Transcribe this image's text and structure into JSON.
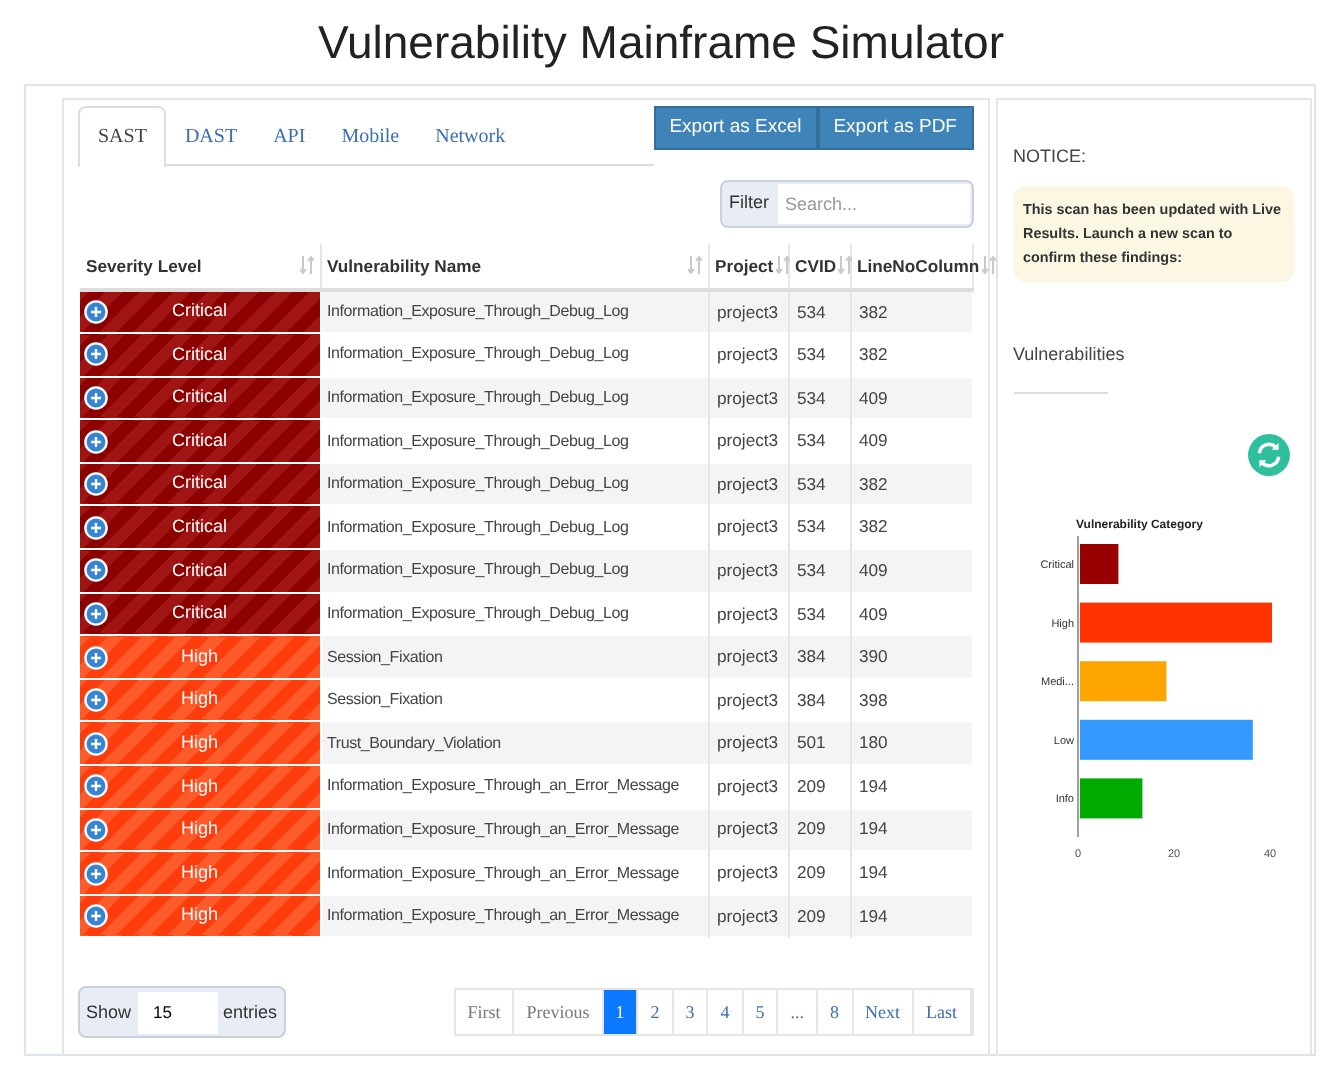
{
  "title": "Vulnerability Mainframe Simulator",
  "tabs": [
    {
      "label": "SAST",
      "selected": true
    },
    {
      "label": "DAST",
      "selected": false
    },
    {
      "label": "API",
      "selected": false
    },
    {
      "label": "Mobile",
      "selected": false
    },
    {
      "label": "Network",
      "selected": false
    }
  ],
  "export_buttons": [
    "Export as Excel",
    "Export as PDF"
  ],
  "filter": {
    "label": "Filter",
    "placeholder": "Search..."
  },
  "table": {
    "columns": [
      "Severity Level",
      "Vulnerability Name",
      "Project",
      "CVID",
      "LineNoColumn"
    ],
    "rows": [
      {
        "kind": "critical",
        "severity": "Critical",
        "name": "Information_Exposure_Through_Debug_Log",
        "project": "project3",
        "cvid": "534",
        "line": "382"
      },
      {
        "kind": "critical",
        "severity": "Critical",
        "name": "Information_Exposure_Through_Debug_Log",
        "project": "project3",
        "cvid": "534",
        "line": "382"
      },
      {
        "kind": "critical",
        "severity": "Critical",
        "name": "Information_Exposure_Through_Debug_Log",
        "project": "project3",
        "cvid": "534",
        "line": "409"
      },
      {
        "kind": "critical",
        "severity": "Critical",
        "name": "Information_Exposure_Through_Debug_Log",
        "project": "project3",
        "cvid": "534",
        "line": "409"
      },
      {
        "kind": "critical",
        "severity": "Critical",
        "name": "Information_Exposure_Through_Debug_Log",
        "project": "project3",
        "cvid": "534",
        "line": "382"
      },
      {
        "kind": "critical",
        "severity": "Critical",
        "name": "Information_Exposure_Through_Debug_Log",
        "project": "project3",
        "cvid": "534",
        "line": "382"
      },
      {
        "kind": "critical",
        "severity": "Critical",
        "name": "Information_Exposure_Through_Debug_Log",
        "project": "project3",
        "cvid": "534",
        "line": "409"
      },
      {
        "kind": "critical",
        "severity": "Critical",
        "name": "Information_Exposure_Through_Debug_Log",
        "project": "project3",
        "cvid": "534",
        "line": "409"
      },
      {
        "kind": "high",
        "severity": "High",
        "name": "Session_Fixation",
        "project": "project3",
        "cvid": "384",
        "line": "390"
      },
      {
        "kind": "high",
        "severity": "High",
        "name": "Session_Fixation",
        "project": "project3",
        "cvid": "384",
        "line": "398"
      },
      {
        "kind": "high",
        "severity": "High",
        "name": "Trust_Boundary_Violation",
        "project": "project3",
        "cvid": "501",
        "line": "180"
      },
      {
        "kind": "high",
        "severity": "High",
        "name": "Information_Exposure_Through_an_Error_Message",
        "project": "project3",
        "cvid": "209",
        "line": "194"
      },
      {
        "kind": "high",
        "severity": "High",
        "name": "Information_Exposure_Through_an_Error_Message",
        "project": "project3",
        "cvid": "209",
        "line": "194"
      },
      {
        "kind": "high",
        "severity": "High",
        "name": "Information_Exposure_Through_an_Error_Message",
        "project": "project3",
        "cvid": "209",
        "line": "194"
      },
      {
        "kind": "high",
        "severity": "High",
        "name": "Information_Exposure_Through_an_Error_Message",
        "project": "project3",
        "cvid": "209",
        "line": "194"
      }
    ]
  },
  "page_length": {
    "prefix": "Show",
    "value": "15",
    "suffix": "entries"
  },
  "pagination": [
    {
      "label": "First",
      "selected": false
    },
    {
      "label": "Previous",
      "selected": false
    },
    {
      "label": "1",
      "selected": true
    },
    {
      "label": "2",
      "selected": false
    },
    {
      "label": "3",
      "selected": false
    },
    {
      "label": "4",
      "selected": false
    },
    {
      "label": "5",
      "selected": false
    },
    {
      "label": "...",
      "selected": false
    },
    {
      "label": "8",
      "selected": false
    },
    {
      "label": "Next",
      "selected": false
    },
    {
      "label": "Last",
      "selected": false
    }
  ],
  "notice": {
    "heading": "NOTICE:",
    "message": "This scan has been updated with Live Results. Launch a new scan to confirm these findings:"
  },
  "vulnerabilities_heading": "Vulnerabilities",
  "chart_data": {
    "type": "bar",
    "orientation": "horizontal",
    "title": "Vulnerability Category",
    "series": [
      {
        "name": "Critical",
        "color": "#990000",
        "values": [
          8,
          null,
          null,
          null,
          null
        ]
      },
      {
        "name": "High",
        "color": "#ff3300",
        "values": [
          null,
          40,
          null,
          null,
          null
        ]
      },
      {
        "name": "Medi...",
        "color": "#ffa500",
        "values": [
          null,
          null,
          18,
          null,
          null
        ]
      },
      {
        "name": "Low",
        "color": "#3399ff",
        "values": [
          null,
          null,
          null,
          36,
          null
        ]
      },
      {
        "name": "Info",
        "color": "#00aa00",
        "values": [
          null,
          null,
          null,
          null,
          13
        ]
      }
    ],
    "xticks": [
      0,
      20,
      40
    ],
    "xlim": [
      0,
      40
    ]
  }
}
